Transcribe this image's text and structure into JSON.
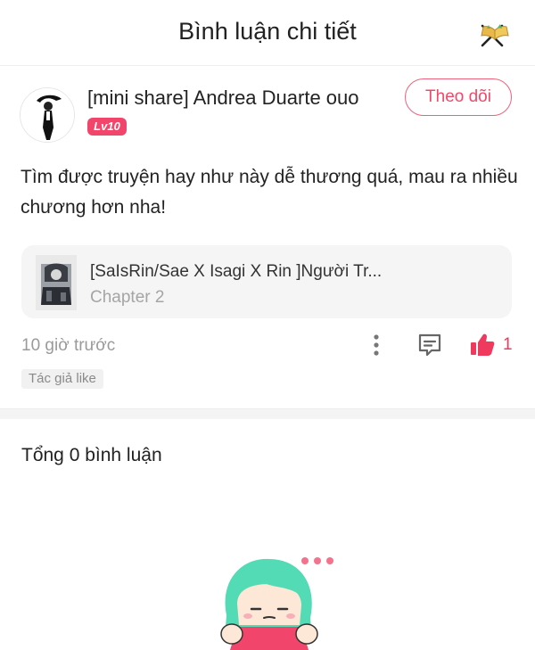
{
  "header": {
    "title": "Bình luận chi tiết"
  },
  "author": {
    "name": "[mini share] Andrea Duarte ouo",
    "level": "Lv10",
    "follow_label": "Theo dõi"
  },
  "comment": {
    "text": "Tìm được truyện hay như này dễ thương quá, mau ra nhiều chương hơn nha!"
  },
  "chapter_card": {
    "story_title": "[SaIsRin/Sae X Isagi X Rin ]Người Tr...",
    "chapter": "Chapter 2"
  },
  "meta": {
    "time": "10 giờ trước",
    "like_count": "1",
    "author_like_tag": "Tác giả like"
  },
  "comments_section": {
    "total_label": "Tổng 0 bình luận"
  },
  "icons": {
    "close": "close-icon",
    "book": "book-icon",
    "more": "more-vertical-icon",
    "reply": "comment-icon",
    "like": "thumbs-up-icon"
  },
  "colors": {
    "accent": "#ef4a6a",
    "badge": "#f2456b",
    "muted": "#9a9a9a"
  }
}
